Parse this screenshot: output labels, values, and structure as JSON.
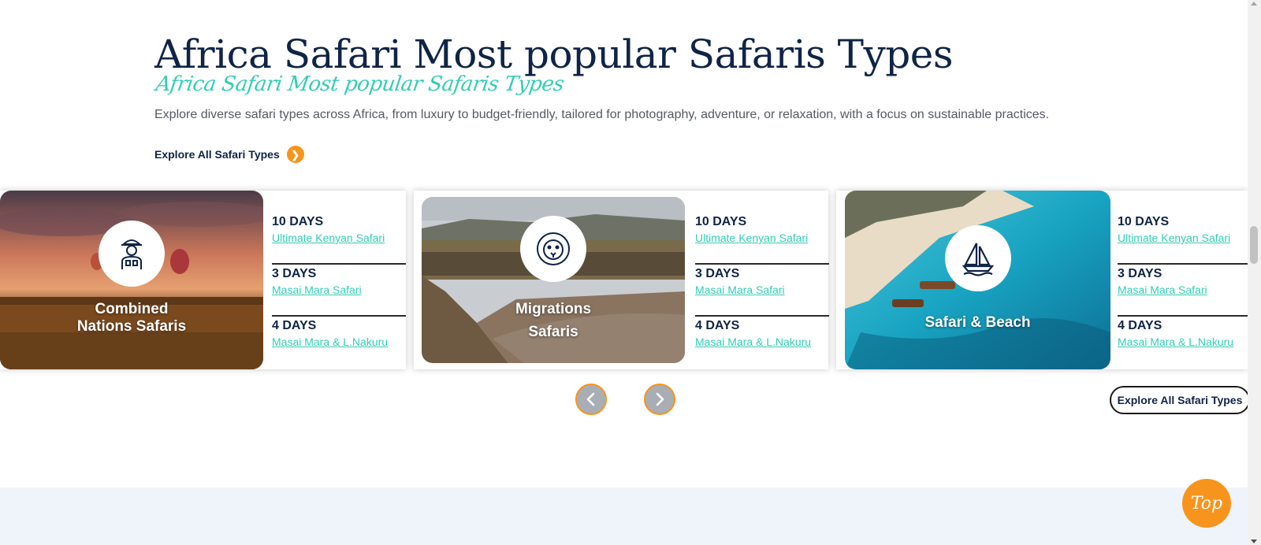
{
  "section": {
    "title": "Africa Safari Most popular Safaris Types",
    "script_title": "Africa Safari Most popular Safaris Types",
    "intro": "Explore diverse safari types across Africa, from luxury to budget-friendly, tailored for photography, adventure, or relaxation, with a focus on sustainable practices.",
    "explore_link": "Explore All Safari Types"
  },
  "cards": [
    {
      "title": "Combined\nNations Safaris",
      "icon": "safari-guide-icon",
      "trips": [
        {
          "days": "10 DAYS",
          "name": "Ultimate Kenyan Safari"
        },
        {
          "days": "3 DAYS",
          "name": "Masai Mara Safari"
        },
        {
          "days": "4 DAYS",
          "name": "Masai Mara & L.Nakuru"
        }
      ]
    },
    {
      "title": "Migrations\nSafaris",
      "icon": "lion-icon",
      "trips": [
        {
          "days": "10 DAYS",
          "name": "Ultimate Kenyan Safari"
        },
        {
          "days": "3 DAYS",
          "name": "Masai Mara Safari"
        },
        {
          "days": "4 DAYS",
          "name": "Masai Mara & L.Nakuru"
        }
      ]
    },
    {
      "title": "Safari & Beach",
      "icon": "sailboat-icon",
      "trips": [
        {
          "days": "10 DAYS",
          "name": "Ultimate Kenyan Safari"
        },
        {
          "days": "3 DAYS",
          "name": "Masai Mara Safari"
        },
        {
          "days": "4 DAYS",
          "name": "Masai Mara & L.Nakuru"
        }
      ]
    }
  ],
  "carousel": {
    "prev_icon": "chevron-left-icon",
    "next_icon": "chevron-right-icon",
    "explore_button": "Explore All Safari Types"
  },
  "back_to_top": "Top",
  "colors": {
    "navy": "#0f2447",
    "teal": "#33cdb5",
    "orange": "#f7941d",
    "light_section": "#eff4fb"
  }
}
